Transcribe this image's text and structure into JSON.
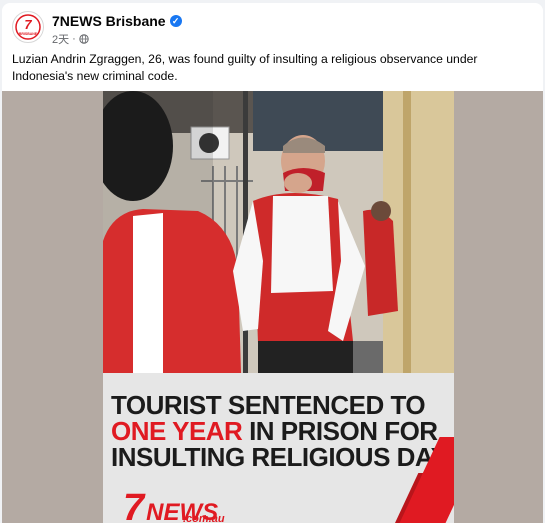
{
  "post": {
    "page_name": "7NEWS Brisbane",
    "verified_icon": "verified-badge-icon",
    "time": "2天",
    "separator": "·",
    "audience_icon": "globe-icon",
    "avatar_text": "7",
    "avatar_subtext": "BRISBANE",
    "caption": "Luzian Andrin Zgraggen, 26, was found guilty of insulting a religious observance under Indonesia's new criminal code."
  },
  "media": {
    "headline_line1": "TOURIST SENTENCED TO",
    "headline_line2_red": "ONE YEAR",
    "headline_line2_rest": " IN PRISON  FOR",
    "headline_line3": "INSULTING RELIGIOUS DAY",
    "logo_7": "7",
    "logo_news": "NEWS",
    "logo_domain": ".com.au"
  },
  "colors": {
    "brand_red": "#e01a22",
    "facebook_blue": "#1877f2",
    "page_bg": "#f0f2f5"
  }
}
